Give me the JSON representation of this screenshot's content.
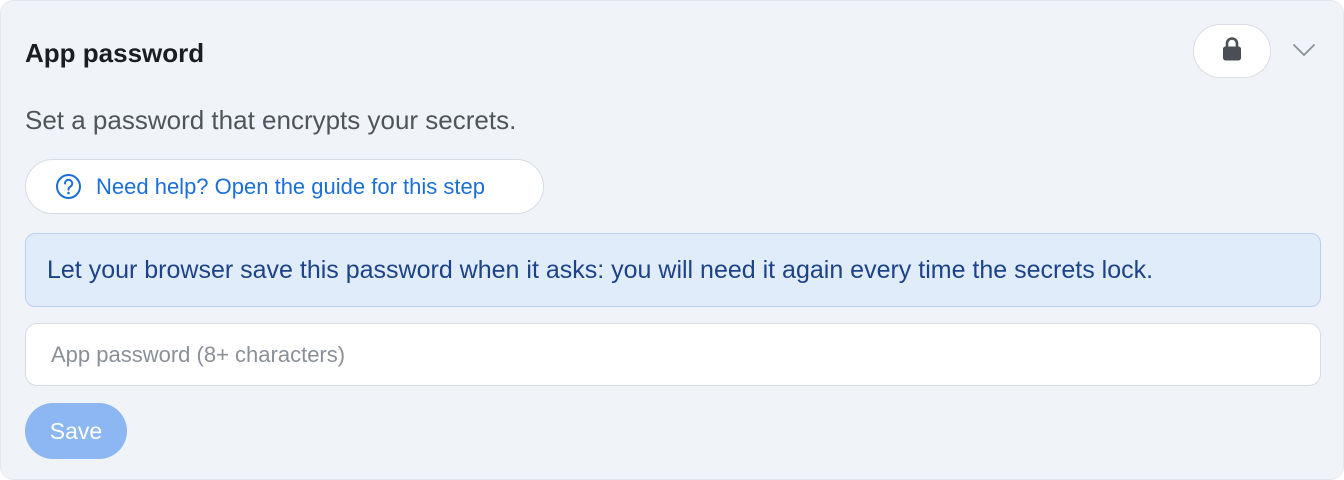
{
  "section": {
    "title": "App password",
    "description": "Set a password that encrypts your secrets."
  },
  "header_controls": {
    "lock_icon": "lock-icon",
    "expand_icon": "chevron-down-icon"
  },
  "help": {
    "icon": "question-circle-icon",
    "label": "Need help? Open the guide for this step"
  },
  "notice": {
    "text": "Let your browser save this password when it asks: you will need it again every time the secrets lock."
  },
  "password_field": {
    "value": "",
    "placeholder": "App password (8+ characters)"
  },
  "actions": {
    "save_label": "Save",
    "save_enabled": false
  },
  "colors": {
    "card_bg": "#f0f4f8",
    "link": "#1a6fd8",
    "notice_bg": "#e1ecfb",
    "notice_text": "#1c4287",
    "save_disabled_bg": "#8db7f2"
  }
}
